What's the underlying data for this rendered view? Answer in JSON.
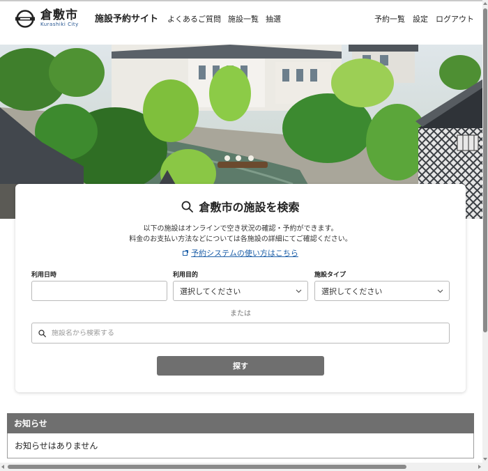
{
  "header": {
    "logo_jp": "倉敷市",
    "logo_en": "Kurashiki City",
    "site_title": "施設予約サイト",
    "nav_left": [
      "よくあるご質問",
      "施設一覧",
      "抽選"
    ],
    "nav_right": [
      "予約一覧",
      "設定",
      "ログアウト"
    ]
  },
  "search": {
    "title": "倉敷市の施設を検索",
    "desc_line1": "以下の施設はオンラインで空き状況の確認・予約ができます。",
    "desc_line2": "料金のお支払い方法などについては各施設の詳細にてご確認ください。",
    "howto_link": "予約システムの使い方はこちら",
    "date_label": "利用日時",
    "date_value": "",
    "purpose_label": "利用目的",
    "purpose_selected": "選択してください",
    "type_label": "施設タイプ",
    "type_selected": "選択してください",
    "or_text": "または",
    "name_placeholder": "施設名から検索する",
    "submit_label": "探す"
  },
  "notice": {
    "heading": "お知らせ",
    "body": "お知らせはありません"
  },
  "colors": {
    "accent": "#6f6f6f",
    "link": "#1d5fa8",
    "brand_blue": "#1d4f8c"
  }
}
